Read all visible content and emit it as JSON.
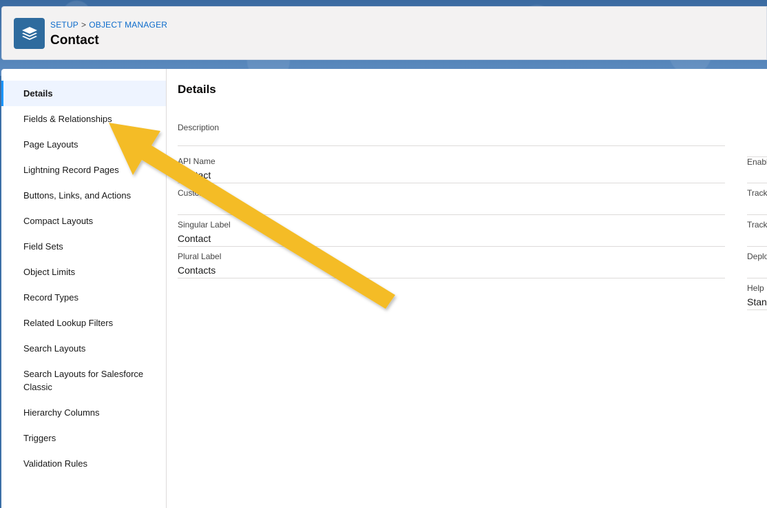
{
  "header": {
    "breadcrumb": {
      "setup": "SETUP",
      "separator": ">",
      "object_manager": "OBJECT MANAGER"
    },
    "title": "Contact",
    "icon": "layers-icon"
  },
  "sidebar": {
    "items": [
      {
        "label": "Details",
        "active": true
      },
      {
        "label": "Fields & Relationships"
      },
      {
        "label": "Page Layouts"
      },
      {
        "label": "Lightning Record Pages"
      },
      {
        "label": "Buttons, Links, and Actions"
      },
      {
        "label": "Compact Layouts"
      },
      {
        "label": "Field Sets"
      },
      {
        "label": "Object Limits"
      },
      {
        "label": "Record Types"
      },
      {
        "label": "Related Lookup Filters"
      },
      {
        "label": "Search Layouts"
      },
      {
        "label": "Search Layouts for Salesforce Classic"
      },
      {
        "label": "Hierarchy Columns"
      },
      {
        "label": "Triggers"
      },
      {
        "label": "Validation Rules"
      }
    ]
  },
  "details": {
    "title": "Details",
    "left_fields": [
      {
        "label": "Description",
        "value": ""
      },
      {
        "label": "API Name",
        "value": "Contact"
      },
      {
        "label": "Custom",
        "value": ""
      },
      {
        "label": "Singular Label",
        "value": "Contact"
      },
      {
        "label": "Plural Label",
        "value": "Contacts"
      }
    ],
    "right_fields": [
      {
        "label": "Enable",
        "value": ""
      },
      {
        "label": "Track",
        "value": ""
      },
      {
        "label": "Track",
        "value": ""
      },
      {
        "label": "Deplo",
        "value": ""
      },
      {
        "label": "Help",
        "value": "Stanc"
      }
    ]
  },
  "colors": {
    "brand_blue": "#2e6b9e",
    "link_blue": "#0b6bcb",
    "active_bg": "#eef4ff",
    "active_border": "#1b96ff",
    "annotation_arrow": "#f4bc25"
  }
}
